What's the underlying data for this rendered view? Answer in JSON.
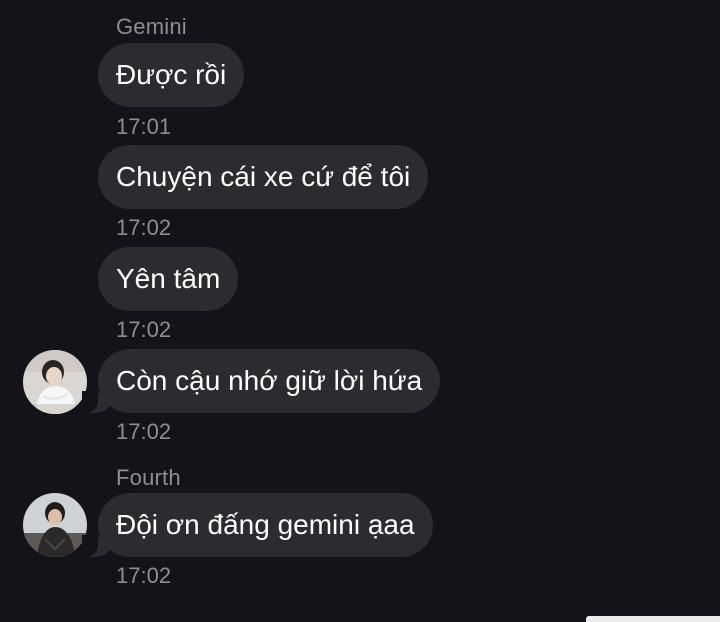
{
  "messages": [
    {
      "sender": "Gemini",
      "text": "Được rồi",
      "time": "17:01"
    },
    {
      "text": "Chuyện cái xe cứ để tôi",
      "time": "17:02"
    },
    {
      "text": "Yên tâm",
      "time": "17:02"
    },
    {
      "text": "Còn cậu nhớ giữ lời hứa",
      "time": "17:02",
      "avatar": "avatar-gemini"
    },
    {
      "sender": "Fourth",
      "text": "Đội ơn đấng gemini ạaa",
      "time": "17:02",
      "avatar": "avatar-fourth"
    }
  ],
  "colors": {
    "background": "#15131a",
    "bubble": "#2c2c30",
    "text": "#ffffff",
    "meta": "#8e8d93"
  }
}
